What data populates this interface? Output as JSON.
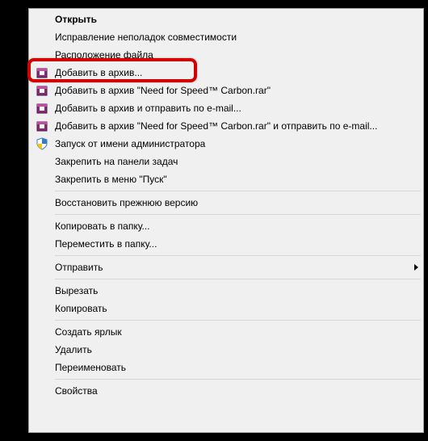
{
  "menu": {
    "open": "Открыть",
    "compat": "Исправление неполадок совместимости",
    "file_location": "Расположение файла",
    "add_to_archive": "Добавить в архив...",
    "add_to_named": "Добавить в архив \"Need for Speed™ Carbon.rar\"",
    "add_and_email": "Добавить в архив и отправить по e-mail...",
    "add_named_and_email": "Добавить в архив \"Need for Speed™ Carbon.rar\" и отправить по e-mail...",
    "run_as_admin": "Запуск от имени администратора",
    "pin_taskbar": "Закрепить на панели задач",
    "pin_start": "Закрепить в меню \"Пуск\"",
    "restore_previous": "Восстановить прежнюю версию",
    "copy_to_folder": "Копировать в папку...",
    "move_to_folder": "Переместить в папку...",
    "send_to": "Отправить",
    "cut": "Вырезать",
    "copy": "Копировать",
    "create_shortcut": "Создать ярлык",
    "delete": "Удалить",
    "rename": "Переименовать",
    "properties": "Свойства"
  }
}
